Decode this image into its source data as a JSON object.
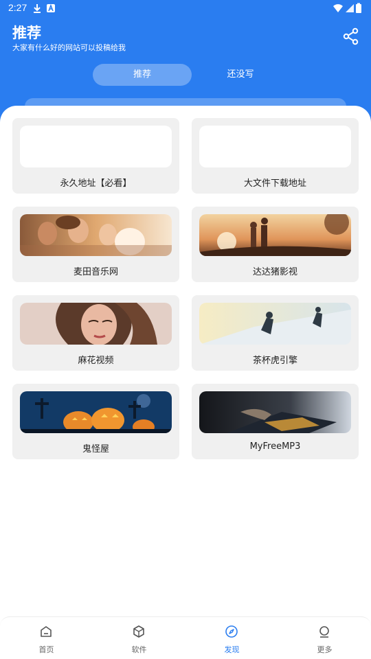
{
  "status_bar": {
    "time": "2:27"
  },
  "header": {
    "title": "推荐",
    "subtitle": "大家有什么好的网站可以投稿给我",
    "share_icon": "share-icon"
  },
  "tabs": [
    {
      "label": "推荐",
      "active": true
    },
    {
      "label": "还没写",
      "active": false
    }
  ],
  "cards": [
    {
      "label": "永久地址【必看】",
      "thumb": "blank"
    },
    {
      "label": "大文件下载地址",
      "thumb": "blank"
    },
    {
      "label": "麦田音乐网",
      "thumb": "friends-photo"
    },
    {
      "label": "达达猪影视",
      "thumb": "family-sunset-photo"
    },
    {
      "label": "麻花视频",
      "thumb": "woman-portrait-photo"
    },
    {
      "label": "茶杯虎引擎",
      "thumb": "hikers-snow-photo"
    },
    {
      "label": "鬼怪屋",
      "thumb": "pumpkins-photo"
    },
    {
      "label": "MyFreeMP3",
      "thumb": "laptop-photo"
    }
  ],
  "bottom_nav": [
    {
      "label": "首页",
      "icon": "home-icon",
      "active": false
    },
    {
      "label": "软件",
      "icon": "cube-icon",
      "active": false
    },
    {
      "label": "发现",
      "icon": "compass-icon",
      "active": true
    },
    {
      "label": "更多",
      "icon": "person-icon",
      "active": false
    }
  ],
  "colors": {
    "primary": "#2a7df0",
    "card_bg": "#f0f0f0"
  }
}
